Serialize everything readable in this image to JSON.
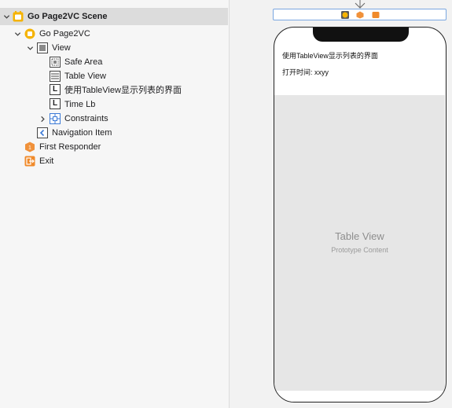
{
  "outline": {
    "scene": "Go Page2VC Scene",
    "controller": "Go Page2VC",
    "view": "View",
    "safe_area": "Safe Area",
    "table_view": "Table View",
    "label_title": "使用TableView显示列表的界面",
    "label_time": "Time Lb",
    "label_icon_letter": "L",
    "constraints": "Constraints",
    "navigation_item": "Navigation Item",
    "first_responder": "First Responder",
    "exit": "Exit"
  },
  "canvas": {
    "phone_title": "使用TableView显示列表的界面",
    "phone_time": "打开时间: xxyy",
    "table_view_title": "Table View",
    "table_view_subtitle": "Prototype Content"
  },
  "colors": {
    "scene_icon": "#f5b301",
    "controller_icon": "#f5b301",
    "first_responder_icon": "#f0913a",
    "exit_icon": "#f08a2a",
    "constraints_icon": "#3c7ad6",
    "selection_border": "#7aa7e0"
  }
}
